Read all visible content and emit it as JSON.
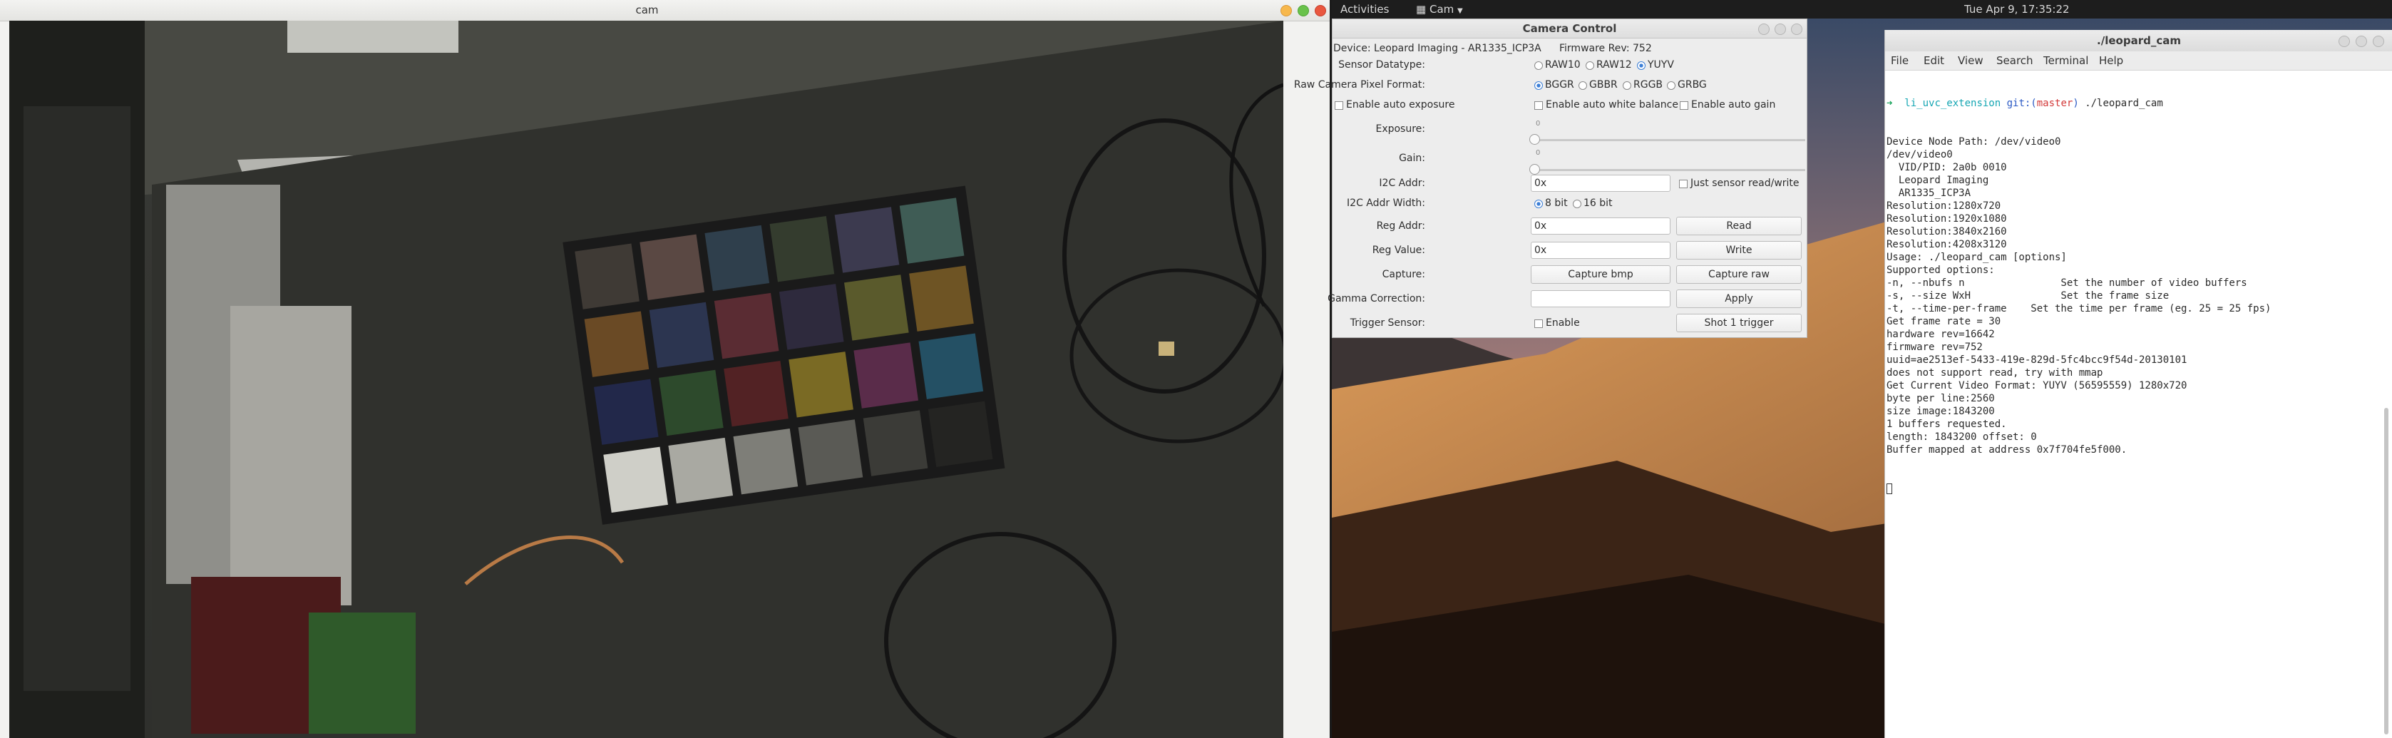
{
  "cam_window": {
    "title": "cam"
  },
  "top_panel": {
    "activities": "Activities",
    "app_name": "Cam",
    "clock": "Tue Apr 9, 17:35:22"
  },
  "camera_control": {
    "title": "Camera Control",
    "device": "Device: Leopard Imaging - AR1335_ICP3A",
    "firmware": "Firmware Rev: 752",
    "sensor_datatype": {
      "label": "Sensor Datatype:",
      "options": [
        "RAW10",
        "RAW12",
        "YUYV"
      ],
      "selected": "YUYV"
    },
    "pixel_format": {
      "label": "Raw Camera Pixel Format:",
      "options": [
        "BGGR",
        "GBBR",
        "RGGB",
        "GRBG"
      ],
      "selected": "BGGR"
    },
    "auto_exposure": "Enable auto exposure",
    "auto_white_balance": "Enable auto white balance",
    "auto_gain": "Enable auto gain",
    "exposure": {
      "label": "Exposure:",
      "value": "0"
    },
    "gain": {
      "label": "Gain:",
      "value": "0"
    },
    "i2c_addr": {
      "label": "I2C Addr:",
      "value": "0x"
    },
    "just_sensor": "Just sensor read/write",
    "i2c_width": {
      "label": "I2C Addr Width:",
      "options": [
        "8 bit",
        "16 bit"
      ],
      "selected": "8 bit"
    },
    "reg_addr": {
      "label": "Reg Addr:",
      "value": "0x"
    },
    "read_button": "Read",
    "reg_value": {
      "label": "Reg Value:",
      "value": "0x"
    },
    "write_button": "Write",
    "capture": {
      "label": "Capture:",
      "bmp_button": "Capture bmp",
      "raw_button": "Capture raw"
    },
    "gamma": {
      "label": "Gamma Correction:",
      "value": "",
      "apply_button": "Apply"
    },
    "trigger": {
      "label": "Trigger Sensor:",
      "enable": "Enable",
      "shot_button": "Shot 1 trigger"
    }
  },
  "terminal": {
    "title": "./leopard_cam",
    "menu": [
      "File",
      "Edit",
      "View",
      "Search",
      "Terminal",
      "Help"
    ],
    "prompt": {
      "arrow": "➜",
      "dir": "li_uvc_extension",
      "git_prefix": "git:(",
      "branch": "master",
      "git_suffix": ")",
      "command": "./leopard_cam"
    },
    "lines": [
      "Device Node Path: /dev/video0",
      "/dev/video0",
      "  VID/PID: 2a0b 0010",
      "  Leopard Imaging",
      "  AR1335_ICP3A",
      "Resolution:1280x720",
      "Resolution:1920x1080",
      "Resolution:3840x2160",
      "Resolution:4208x3120",
      "Usage: ./leopard_cam [options]",
      "Supported options:",
      "-n, --nbufs n                Set the number of video buffers",
      "-s, --size WxH               Set the frame size",
      "-t, --time-per-frame    Set the time per frame (eg. 25 = 25 fps)",
      "Get frame rate = 30",
      "hardware rev=16642",
      "firmware rev=752",
      "uuid=ae2513ef-5433-419e-829d-5fc4bcc9f54d-20130101",
      "does not support read, try with mmap",
      "Get Current Video Format: YUYV (56595559) 1280x720",
      "byte per line:2560",
      "size image:1843200",
      "1 buffers requested.",
      "length: 1843200 offset: 0",
      "Buffer mapped at address 0x7f704fe5f000."
    ]
  },
  "colors": {
    "accent": "#3b7ed6",
    "close": "#e95420",
    "prompt_green": "#18a35a",
    "prompt_cyan": "#15a6b3",
    "branch_red": "#d33a3a"
  }
}
